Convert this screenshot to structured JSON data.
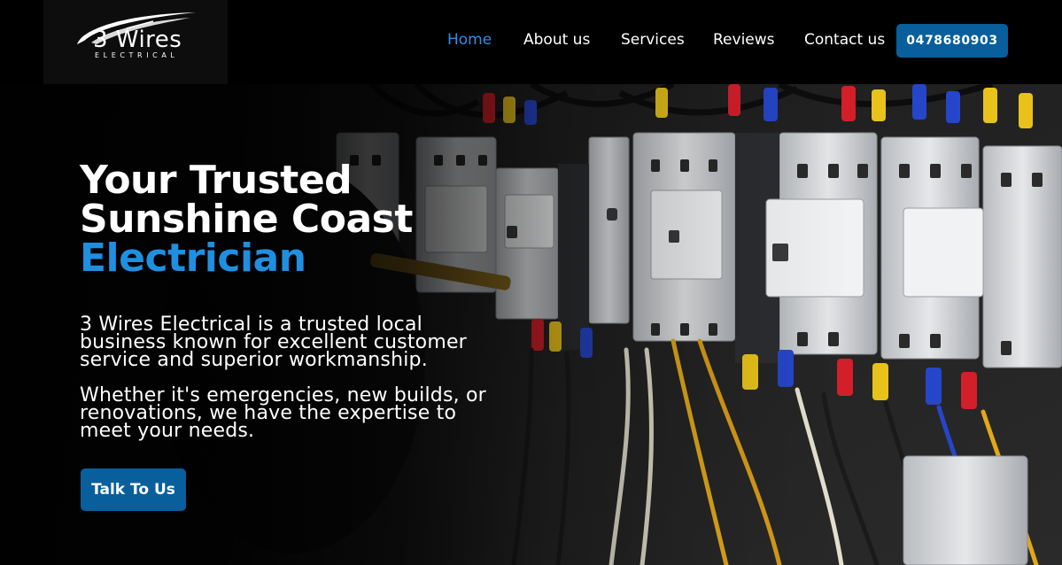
{
  "brand": {
    "logo_name": "3 Wires",
    "logo_tagline": "ELECTRICAL"
  },
  "nav": {
    "items": [
      {
        "label": "Home",
        "active": true
      },
      {
        "label": "About us",
        "active": false
      },
      {
        "label": "Services",
        "active": false
      },
      {
        "label": "Reviews",
        "active": false
      },
      {
        "label": "Contact us",
        "active": false
      }
    ],
    "phone_label": "0478680903"
  },
  "hero": {
    "title_line1": "Your Trusted",
    "title_line2": "Sunshine Coast",
    "title_accent": "Electrician",
    "paragraph1_lines": [
      "3 Wires Electrical is a trusted local",
      "business known for excellent customer",
      "service and superior workmanship."
    ],
    "paragraph2_lines": [
      "Whether it's emergencies, new builds, or",
      "renovations, we have the expertise to",
      "meet your needs."
    ],
    "cta_label": "Talk To Us",
    "background_image": "electrical-panel-photo"
  },
  "colors": {
    "accent_blue": "#1f8fe0",
    "nav_active": "#2f8ee6",
    "button_blue": "#085f9c",
    "background": "#000000"
  }
}
